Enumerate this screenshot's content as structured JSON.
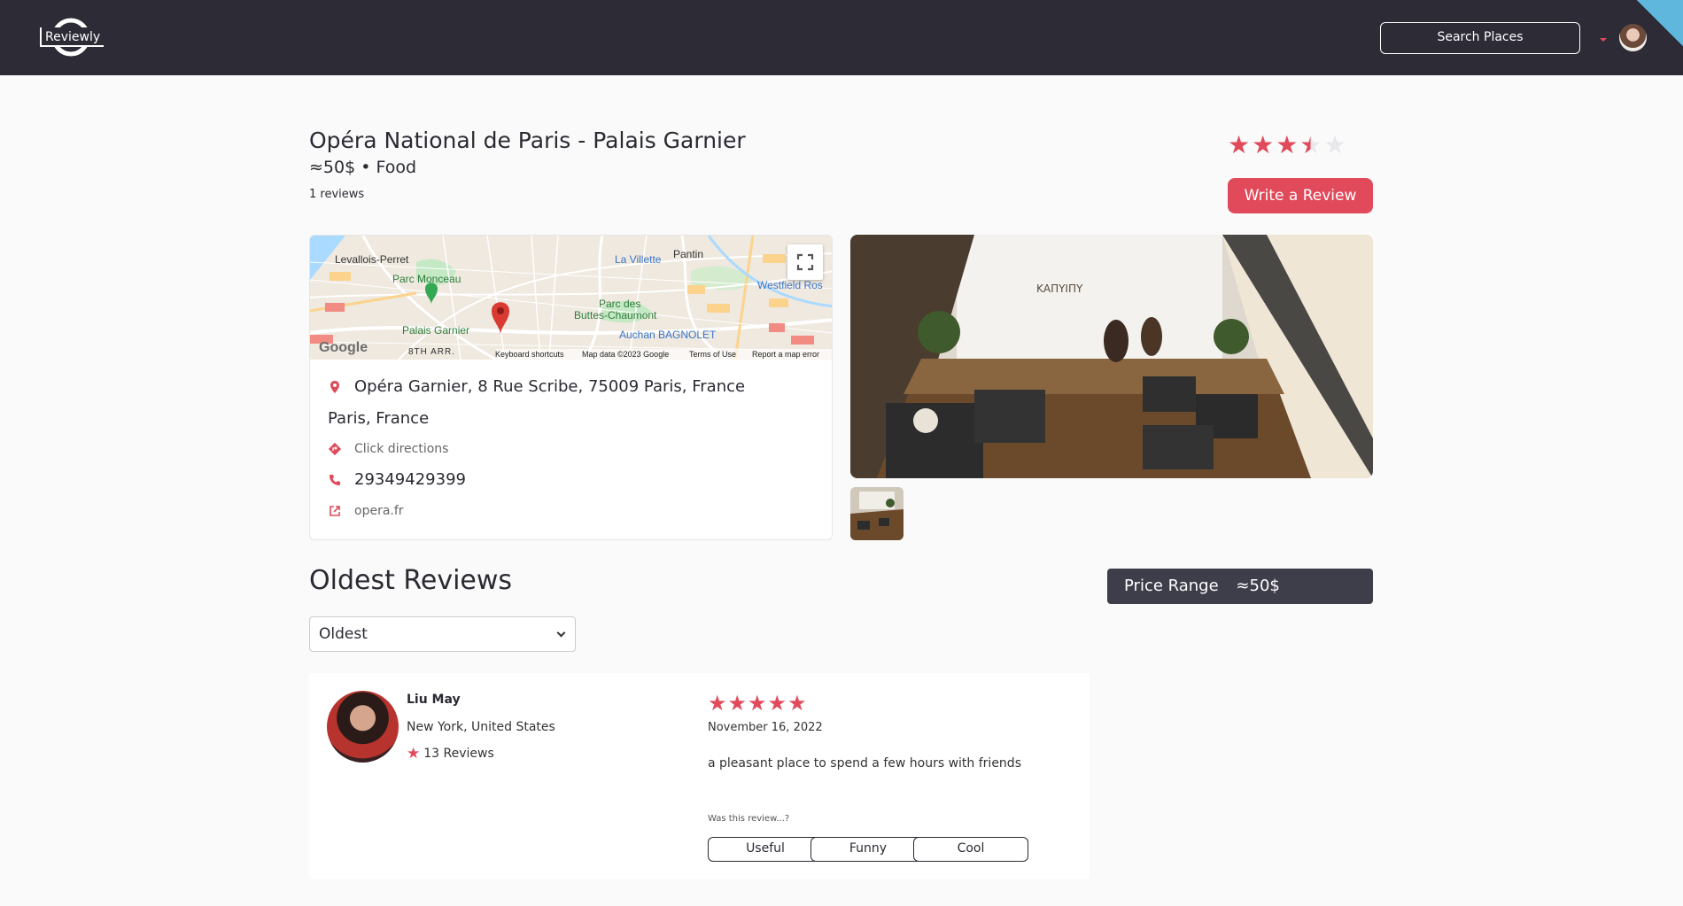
{
  "header": {
    "logo_text": "Reviewly",
    "search_label": "Search Places"
  },
  "place": {
    "title": "Opéra National de Paris - Palais Garnier",
    "price_category": "≈50$ • Food",
    "review_count": "1 reviews",
    "rating": 3.5,
    "rating_max": 5,
    "write_review_label": "Write a Review",
    "address": "Opéra Garnier, 8 Rue Scribe, 75009 Paris, France",
    "city": "Paris, France",
    "directions_label": "Click directions",
    "phone": "29349429399",
    "website": "opera.fr"
  },
  "map": {
    "labels": {
      "levallois": "Levallois-Perret",
      "villette": "La Villette",
      "pantin": "Pantin",
      "monceau": "Parc Monceau",
      "westfield": "Westfield Ros",
      "buttes1": "Parc des",
      "buttes2": "Buttes-Chaumont",
      "garnier": "Palais Garnier",
      "auchan": "Auchan BAGNOLET",
      "arr": "8TH ARR.",
      "google": "Google",
      "shortcuts": "Keyboard shortcuts",
      "mapdata": "Map data ©2023 Google",
      "terms": "Terms of Use",
      "report": "Report a map error"
    }
  },
  "reviews": {
    "section_title": "Oldest Reviews",
    "sort_selected": "Oldest",
    "price_range_label": "Price Range",
    "price_range_value": "≈50$",
    "items": [
      {
        "name": "Liu May",
        "location": "New York, United States",
        "review_count": "13 Reviews",
        "rating": 5,
        "date": "November 16, 2022",
        "text": "a pleasant place to spend a few hours with friends",
        "ask": "Was this review...?",
        "useful_label": "Useful",
        "funny_label": "Funny",
        "cool_label": "Cool"
      }
    ]
  },
  "colors": {
    "accent": "#e04a5a",
    "header_bg": "#2c2b36",
    "price_box_bg": "#3e3d4a",
    "star_empty": "#e8e8ec",
    "corner": "#5fb7de"
  }
}
